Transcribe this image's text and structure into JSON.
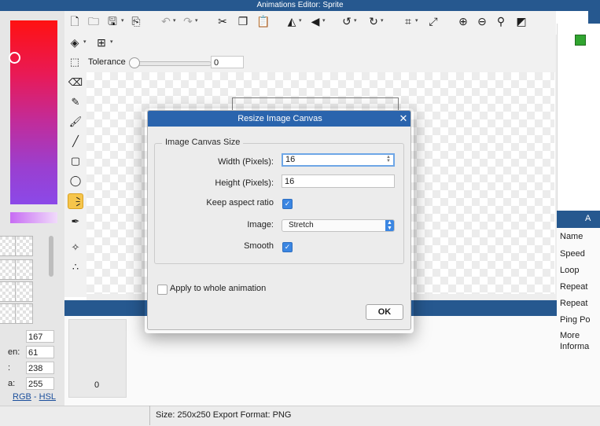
{
  "window": {
    "title": "Animations Editor: Sprite"
  },
  "color_panel": {
    "labels": [
      "",
      "en:",
      ":",
      "a:"
    ],
    "values": [
      "167",
      "61",
      "238",
      "255"
    ],
    "mode_rgb": "RGB",
    "mode_sep": " - ",
    "mode_hsl": "HSL"
  },
  "toolbar": {
    "tolerance_label": "Tolerance",
    "tolerance_value": "0"
  },
  "frames": {
    "frame_number": "0"
  },
  "properties_panel": {
    "header": "A",
    "rows": [
      "Name",
      "Speed",
      "Loop",
      "Repeat",
      "Repeat",
      "Ping Po",
      "More",
      "Informa"
    ]
  },
  "status_bar": {
    "text": "Size: 250x250   Export Format: PNG"
  },
  "dialog": {
    "title": "Resize Image Canvas",
    "close_glyph": "✕",
    "group_label": "Image Canvas Size",
    "width_label": "Width (Pixels):",
    "width_value": "16",
    "height_label": "Height (Pixels):",
    "height_value": "16",
    "keep_aspect_label": "Keep aspect ratio",
    "keep_aspect_checked": true,
    "image_label": "Image:",
    "image_selected": "Stretch",
    "smooth_label": "Smooth",
    "smooth_checked": true,
    "apply_label": "Apply to whole animation",
    "apply_checked": false,
    "ok_label": "OK"
  },
  "icons": {
    "new": "new-file-icon",
    "open": "open-folder-icon",
    "save": "save-icon",
    "export": "export-icon",
    "undo": "undo-icon",
    "redo": "redo-icon",
    "cut": "cut-icon",
    "copy": "copy-icon",
    "paste": "paste-icon",
    "flip_h": "flip-horizontal-icon",
    "flip_v": "flip-vertical-icon",
    "rotate_ccw": "rotate-left-icon",
    "rotate_cw": "rotate-right-icon",
    "crop": "crop-icon",
    "resize": "resize-icon",
    "zoom_in": "zoom-in-icon",
    "zoom_out": "zoom-out-icon",
    "zoom_fit": "zoom-fit-icon",
    "color_fill": "contrast-icon",
    "layers": "layers-icon",
    "grid": "grid-icon",
    "select": "selection-icon",
    "eraser": "eraser-icon",
    "pencil": "pencil-icon",
    "brush": "brush-icon",
    "line": "line-icon",
    "rectangle": "rectangle-icon",
    "ellipse": "ellipse-icon",
    "bucket": "paint-bucket-icon",
    "eyedropper": "eyedropper-icon",
    "move": "move-icon",
    "nodes": "nodes-icon"
  },
  "colors": {
    "accent_blue": "#26588f",
    "dialog_title": "#2a64ad",
    "checkbox_blue": "#3b86e2",
    "active_tool": "#f6c54b"
  }
}
